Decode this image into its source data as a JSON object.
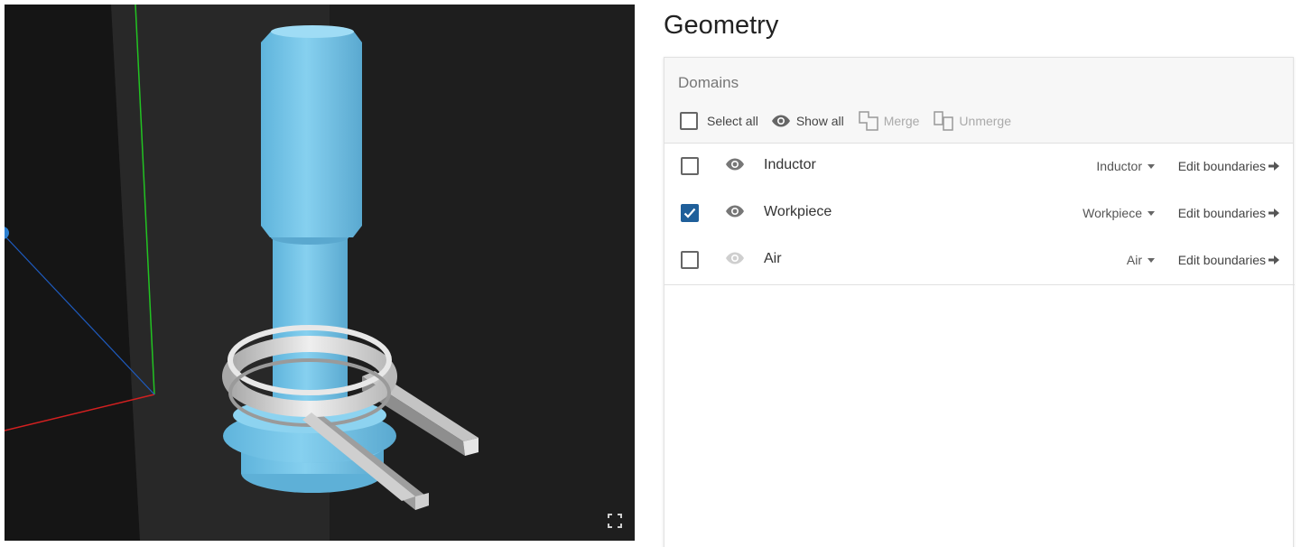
{
  "page": {
    "title": "Geometry"
  },
  "domains": {
    "title": "Domains",
    "toolbar": {
      "select_all": "Select all",
      "show_all": "Show all",
      "merge": "Merge",
      "unmerge": "Unmerge"
    },
    "rows": [
      {
        "name": "Inductor",
        "checked": false,
        "visible": true,
        "type": "Inductor",
        "edit": "Edit boundaries"
      },
      {
        "name": "Workpiece",
        "checked": true,
        "visible": true,
        "type": "Workpiece",
        "edit": "Edit boundaries"
      },
      {
        "name": "Air",
        "checked": false,
        "visible": false,
        "type": "Air",
        "edit": "Edit boundaries"
      }
    ]
  },
  "colors": {
    "viewport_bg": "#1e1e1e",
    "workpiece": "#7ecbea",
    "inductor": "#d9d9d9",
    "checkbox_checked": "#1f5f9a",
    "axis_x": "#d32020",
    "axis_y": "#22c322",
    "axis_z": "#1e5bbf"
  },
  "icons": {
    "show": "eye-icon",
    "merge": "merge-icon",
    "unmerge": "unmerge-icon",
    "edit": "arrow-right-icon",
    "fullscreen": "fullscreen-icon"
  }
}
